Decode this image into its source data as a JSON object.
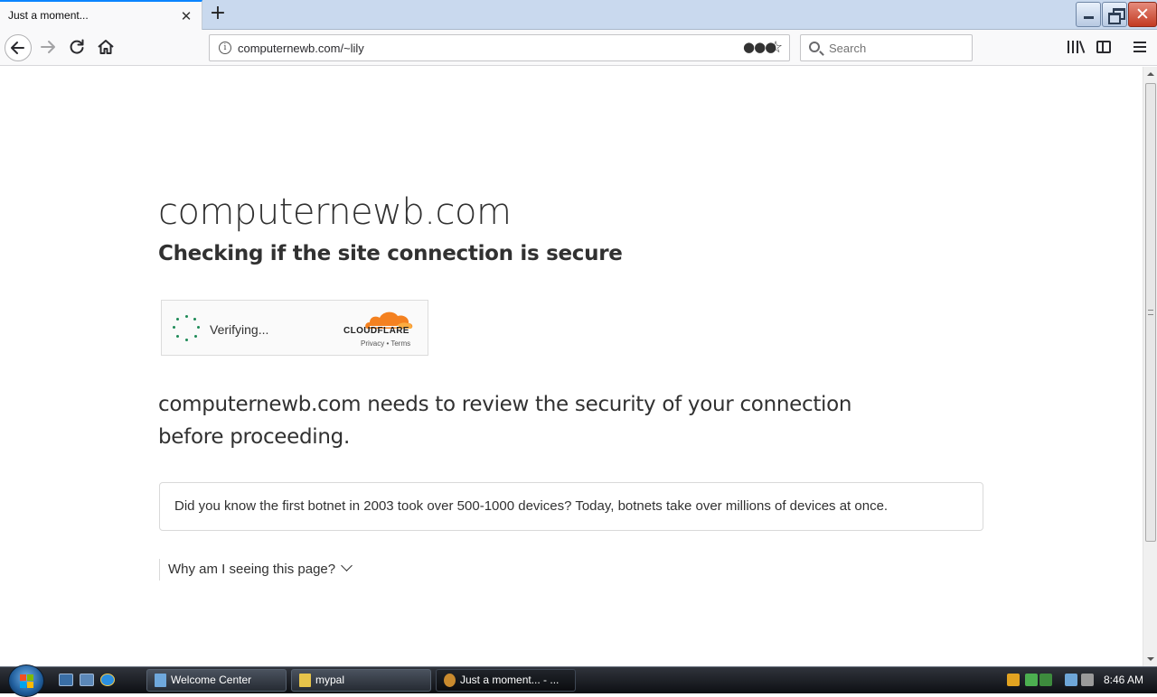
{
  "browser": {
    "tab": {
      "title": "Just a moment..."
    },
    "address": {
      "url": "computernewb.com/~lily"
    },
    "search": {
      "placeholder": "Search"
    }
  },
  "page": {
    "site_title": "computernewb.com",
    "subtitle": "Checking if the site connection is secure",
    "widget": {
      "status": "Verifying...",
      "brand": "CLOUDFLARE",
      "links": "Privacy • Terms"
    },
    "review_text": "computernewb.com needs to review the security of your connection before proceeding.",
    "did_you_know": "Did you know the first botnet in 2003 took over 500-1000 devices? Today, botnets take over millions of devices at once.",
    "why_label": "Why am I seeing this page?"
  },
  "taskbar": {
    "buttons": [
      {
        "label": "Welcome Center",
        "icon": "welcome-center-icon"
      },
      {
        "label": "mypal",
        "icon": "folder-icon"
      },
      {
        "label": "Just a moment... - ...",
        "icon": "mypal-browser-icon",
        "active": true
      }
    ],
    "clock": "8:46 AM"
  },
  "colors": {
    "accent": "#0a84ff",
    "spinner": "#1d8a57",
    "cloudflare_orange": "#f48120",
    "text": "#313131"
  }
}
